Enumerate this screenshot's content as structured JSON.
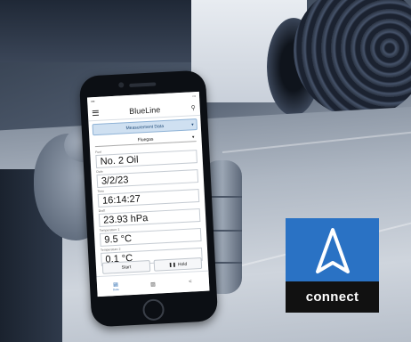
{
  "phone_app": {
    "app_title": "BlueLine",
    "tab": "Measurement Data",
    "selector": "Fluegаs",
    "fields": [
      {
        "label": "Fuel",
        "value": "No. 2 Oil"
      },
      {
        "label": "Date",
        "value": "3/2/23"
      },
      {
        "label": "Time",
        "value": "16:14:27"
      },
      {
        "label": "Draft",
        "value": "23.93 hPa"
      },
      {
        "label": "Temperature 1",
        "value": "9.5 °C"
      },
      {
        "label": "Temperature 2",
        "value": "0.1 °C"
      }
    ],
    "buttons": {
      "start": "Start",
      "hold": "Hold"
    },
    "nav": [
      {
        "icon": "data-icon",
        "label": "Data"
      },
      {
        "icon": "chart-icon",
        "label": ""
      },
      {
        "icon": "share-icon",
        "label": ""
      }
    ]
  },
  "badge": {
    "text": "connect",
    "color": "#2a72c4"
  }
}
